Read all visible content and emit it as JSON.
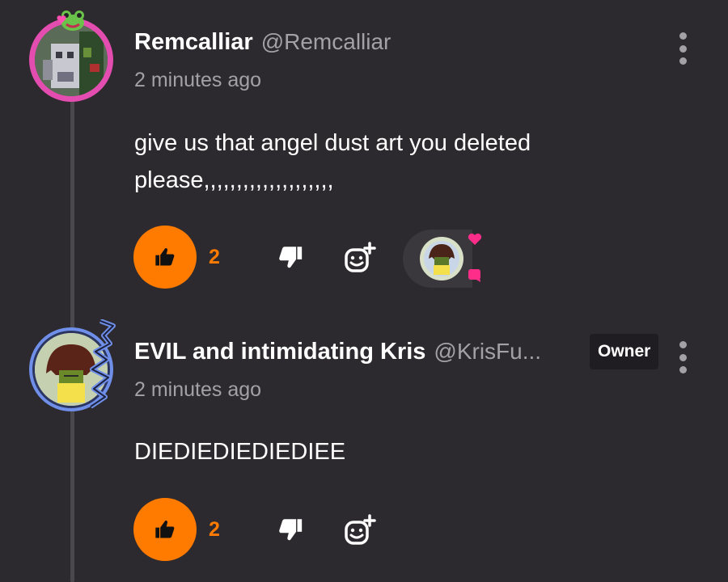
{
  "comments": [
    {
      "name": "Remcalliar",
      "handle": "@Remcalliar",
      "time": "2 minutes ago",
      "text_lines": [
        "give us that angel dust art you deleted",
        "please,,,,,,,,,,,,,,,,,,,,"
      ],
      "likes": "2",
      "avatar_icon": "frog-minecraft-avatar",
      "ring_color": "#e44db0"
    },
    {
      "name": "EVIL and intimidating Kris",
      "handle": "@KrisFu...",
      "badge": "Owner",
      "time": "2 minutes ago",
      "text_lines": [
        "DIEDIEDIEDIEDIEE"
      ],
      "likes": "2",
      "avatar_icon": "kris-avatar",
      "ring_color": "#6f8fe8"
    }
  ],
  "colors": {
    "background": "#2c2a2e",
    "accent": "#ff7b00",
    "muted": "#a3a1a6"
  }
}
